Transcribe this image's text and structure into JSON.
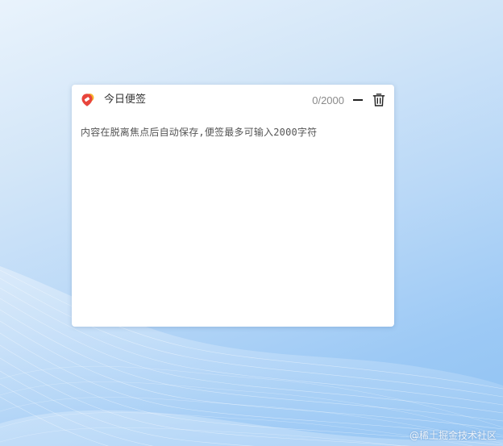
{
  "note": {
    "title": "今日便签",
    "char_count": "0/2000",
    "placeholder_text": "内容在脱离焦点后自动保存,便签最多可输入2000字符"
  },
  "window_controls": {
    "minimize_icon": "minus-icon",
    "delete_icon": "trash-icon"
  },
  "watermark": {
    "text": "@稀土掘金技术社区"
  },
  "colors": {
    "logo_red": "#e8453c",
    "logo_yellow": "#f7b52c",
    "background_blue": "#9cc9f5"
  }
}
